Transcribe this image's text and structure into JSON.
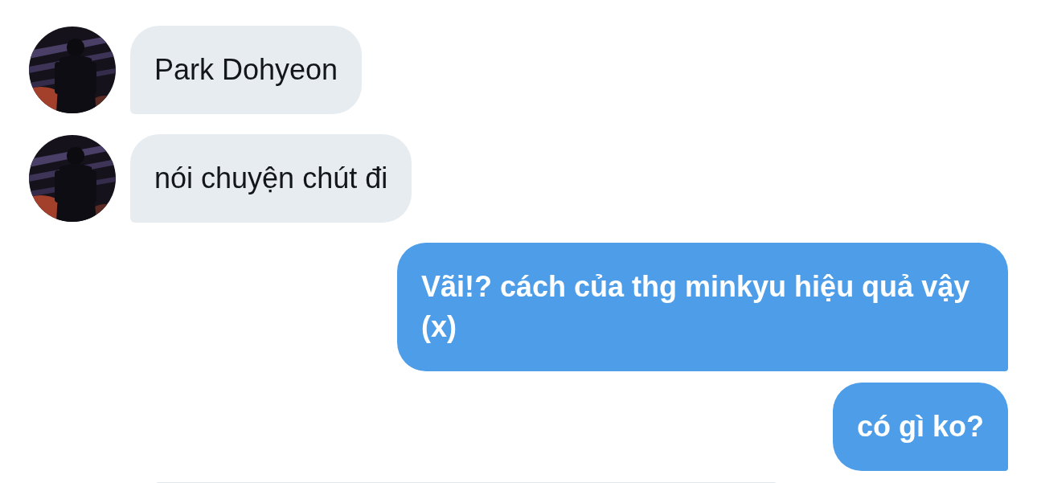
{
  "messages": [
    {
      "kind": "received",
      "text": "Park Dohyeon"
    },
    {
      "kind": "received",
      "text": "nói chuyện chút đi"
    },
    {
      "kind": "sent",
      "text": "Vãi!? cách của thg minkyu hiệu quả vậy (x)"
    },
    {
      "kind": "sent",
      "text": "có gì ko?"
    }
  ]
}
